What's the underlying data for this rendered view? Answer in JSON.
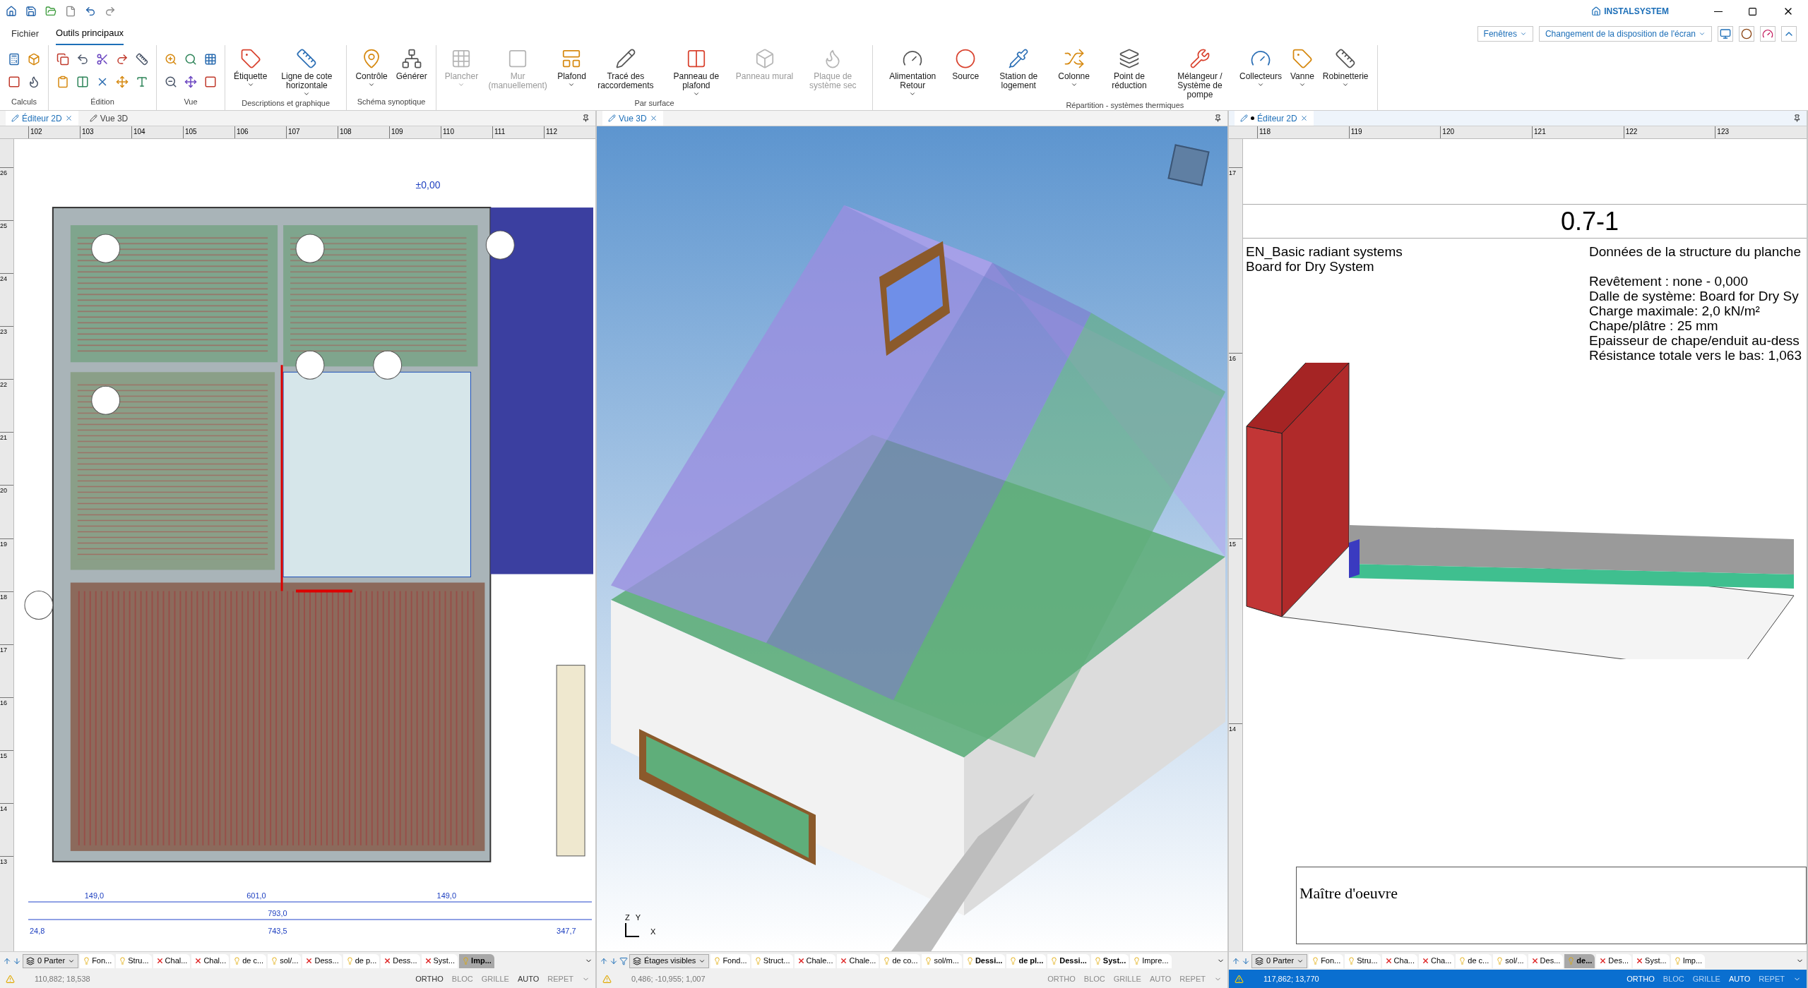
{
  "ribbon": {
    "tabs": [
      {
        "label": "Fichier",
        "selected": false
      },
      {
        "label": "Outils principaux",
        "selected": true
      }
    ],
    "right_controls": {
      "windows": "Fenêtres",
      "layout": "Changement de la disposition de l'écran"
    },
    "logo": "INSTALSYSTEM",
    "groups": [
      {
        "title": "Calculs",
        "kind": "tools"
      },
      {
        "title": "Édition",
        "kind": "tools"
      },
      {
        "title": "Vue",
        "kind": "tools"
      },
      {
        "title": "Descriptions et graphique",
        "kind": "buttons",
        "buttons": [
          {
            "label": "Étiquette",
            "dropdown": true,
            "disabled": false
          },
          {
            "label": "Ligne de cote horizontale",
            "dropdown": true,
            "disabled": false
          }
        ]
      },
      {
        "title": "Schéma synoptique",
        "kind": "buttons",
        "buttons": [
          {
            "label": "Contrôle",
            "dropdown": true,
            "disabled": false
          },
          {
            "label": "Générer",
            "dropdown": false,
            "disabled": false
          }
        ]
      },
      {
        "title": "Par surface",
        "kind": "buttons",
        "buttons": [
          {
            "label": "Plancher",
            "dropdown": true,
            "disabled": true
          },
          {
            "label": "Mur (manuellement)",
            "dropdown": false,
            "disabled": true
          },
          {
            "label": "Plafond",
            "dropdown": true,
            "disabled": false
          },
          {
            "label": "Tracé des raccordements",
            "dropdown": false,
            "disabled": false
          },
          {
            "label": "Panneau de plafond",
            "dropdown": true,
            "disabled": false
          },
          {
            "label": "Panneau mural",
            "dropdown": false,
            "disabled": true
          },
          {
            "label": "Plaque de système sec",
            "dropdown": false,
            "disabled": true
          }
        ]
      },
      {
        "title": "Répartition - systèmes thermiques",
        "kind": "buttons",
        "buttons": [
          {
            "label": "Alimentation Retour",
            "dropdown": true,
            "disabled": false
          },
          {
            "label": "Source",
            "dropdown": false,
            "disabled": false
          },
          {
            "label": "Station de logement",
            "dropdown": false,
            "disabled": false
          },
          {
            "label": "Colonne",
            "dropdown": true,
            "disabled": false
          },
          {
            "label": "Point de réduction",
            "dropdown": false,
            "disabled": false
          },
          {
            "label": "Mélangeur / Système de pompe",
            "dropdown": false,
            "disabled": false
          },
          {
            "label": "Collecteurs",
            "dropdown": true,
            "disabled": false
          },
          {
            "label": "Vanne",
            "dropdown": true,
            "disabled": false
          },
          {
            "label": "Robinetterie",
            "dropdown": true,
            "disabled": false
          }
        ]
      }
    ]
  },
  "panels": [
    {
      "kind": "plan",
      "active": false,
      "tabs": [
        {
          "label": "Éditeur 2D",
          "selected": true
        },
        {
          "label": "Vue 3D",
          "selected": false
        }
      ],
      "ruler": [
        "102",
        "103",
        "104",
        "105",
        "106",
        "107",
        "108",
        "109",
        "110",
        "111",
        "112"
      ],
      "vruler": [
        "26",
        "25",
        "24",
        "23",
        "22",
        "21",
        "20",
        "19",
        "18",
        "17",
        "16",
        "15",
        "14",
        "13"
      ],
      "dims": [
        "±0,00",
        "149,0",
        "601,0",
        "149,0",
        "793,0",
        "24,8",
        "743,5",
        "347,7"
      ],
      "floor": "0 Parter",
      "layers": [
        {
          "label": "Fon...",
          "visible": true,
          "selected": false,
          "bold": false
        },
        {
          "label": "Stru...",
          "visible": true,
          "selected": false,
          "bold": false
        },
        {
          "label": "Chal...",
          "visible": false,
          "selected": false,
          "bold": false
        },
        {
          "label": "Chal...",
          "visible": false,
          "selected": false,
          "bold": false
        },
        {
          "label": "de c...",
          "visible": true,
          "selected": false,
          "bold": false
        },
        {
          "label": "sol/...",
          "visible": true,
          "selected": false,
          "bold": false
        },
        {
          "label": "Dess...",
          "visible": false,
          "selected": false,
          "bold": false
        },
        {
          "label": "de p...",
          "visible": true,
          "selected": false,
          "bold": false
        },
        {
          "label": "Dess...",
          "visible": false,
          "selected": false,
          "bold": false
        },
        {
          "label": "Syst...",
          "visible": false,
          "selected": false,
          "bold": false
        },
        {
          "label": "Imp...",
          "visible": true,
          "selected": true,
          "bold": true
        }
      ],
      "coords": "110,882; 18,538",
      "modes": [
        {
          "label": "ORTHO",
          "on": true
        },
        {
          "label": "BLOC",
          "on": false
        },
        {
          "label": "GRILLE",
          "on": false
        },
        {
          "label": "AUTO",
          "on": true
        },
        {
          "label": "REPET",
          "on": false
        }
      ]
    },
    {
      "kind": "view3d",
      "active": false,
      "tabs": [
        {
          "label": "Vue 3D",
          "selected": true
        }
      ],
      "axes": [
        "Z",
        "Y",
        "X"
      ],
      "floor": "Étages visibles",
      "layers": [
        {
          "label": "Fond...",
          "visible": true,
          "selected": false,
          "bold": false
        },
        {
          "label": "Struct...",
          "visible": true,
          "selected": false,
          "bold": false
        },
        {
          "label": "Chale...",
          "visible": false,
          "selected": false,
          "bold": false
        },
        {
          "label": "Chale...",
          "visible": false,
          "selected": false,
          "bold": false
        },
        {
          "label": "de co...",
          "visible": true,
          "selected": false,
          "bold": false
        },
        {
          "label": "sol/m...",
          "visible": true,
          "selected": false,
          "bold": false
        },
        {
          "label": "Dessi...",
          "visible": true,
          "selected": false,
          "bold": true
        },
        {
          "label": "de pl...",
          "visible": true,
          "selected": false,
          "bold": true
        },
        {
          "label": "Dessi...",
          "visible": true,
          "selected": false,
          "bold": true
        },
        {
          "label": "Syst...",
          "visible": true,
          "selected": false,
          "bold": true
        },
        {
          "label": "Impre...",
          "visible": true,
          "selected": false,
          "bold": false
        }
      ],
      "coords": "0,486; -10,955; 1,007",
      "modes": [
        {
          "label": "ORTHO",
          "on": false
        },
        {
          "label": "BLOC",
          "on": false
        },
        {
          "label": "GRILLE",
          "on": false
        },
        {
          "label": "AUTO",
          "on": false
        },
        {
          "label": "REPET",
          "on": false
        }
      ]
    },
    {
      "kind": "sheet",
      "active": true,
      "tabs": [
        {
          "label": "Éditeur 2D",
          "selected": true,
          "modified": true
        }
      ],
      "ruler": [
        "118",
        "119",
        "120",
        "121",
        "122",
        "123"
      ],
      "vruler": [
        "17",
        "16",
        "15",
        "14"
      ],
      "sheet": {
        "number": "0.7-1",
        "system": [
          "EN_Basic radiant systems",
          "Board for Dry System"
        ],
        "heading": "Données de la structure du planche",
        "details": [
          "Revêtement : none - 0,000",
          "Dalle de système: Board for Dry Sy",
          "Charge maximale: 2,0 kN/m²",
          "Chape/plâtre : 25 mm",
          "Epaisseur de chape/enduit au-dess",
          "Résistance totale vers le bas: 1,063"
        ],
        "owner": "Maître d'oeuvre"
      },
      "floor": "0 Parter",
      "layers": [
        {
          "label": "Fon...",
          "visible": true,
          "selected": false,
          "bold": false
        },
        {
          "label": "Stru...",
          "visible": true,
          "selected": false,
          "bold": false
        },
        {
          "label": "Cha...",
          "visible": false,
          "selected": false,
          "bold": false
        },
        {
          "label": "Cha...",
          "visible": false,
          "selected": false,
          "bold": false
        },
        {
          "label": "de c...",
          "visible": true,
          "selected": false,
          "bold": false
        },
        {
          "label": "sol/...",
          "visible": true,
          "selected": false,
          "bold": false
        },
        {
          "label": "Des...",
          "visible": false,
          "selected": false,
          "bold": false
        },
        {
          "label": "de...",
          "visible": true,
          "selected": true,
          "bold": true
        },
        {
          "label": "Des...",
          "visible": false,
          "selected": false,
          "bold": false
        },
        {
          "label": "Syst...",
          "visible": false,
          "selected": false,
          "bold": false
        },
        {
          "label": "Imp...",
          "visible": true,
          "selected": false,
          "bold": false
        }
      ],
      "coords": "117,862; 13,770",
      "modes": [
        {
          "label": "ORTHO",
          "on": true
        },
        {
          "label": "BLOC",
          "on": false
        },
        {
          "label": "GRILLE",
          "on": false
        },
        {
          "label": "AUTO",
          "on": true
        },
        {
          "label": "REPET",
          "on": false
        }
      ]
    }
  ]
}
